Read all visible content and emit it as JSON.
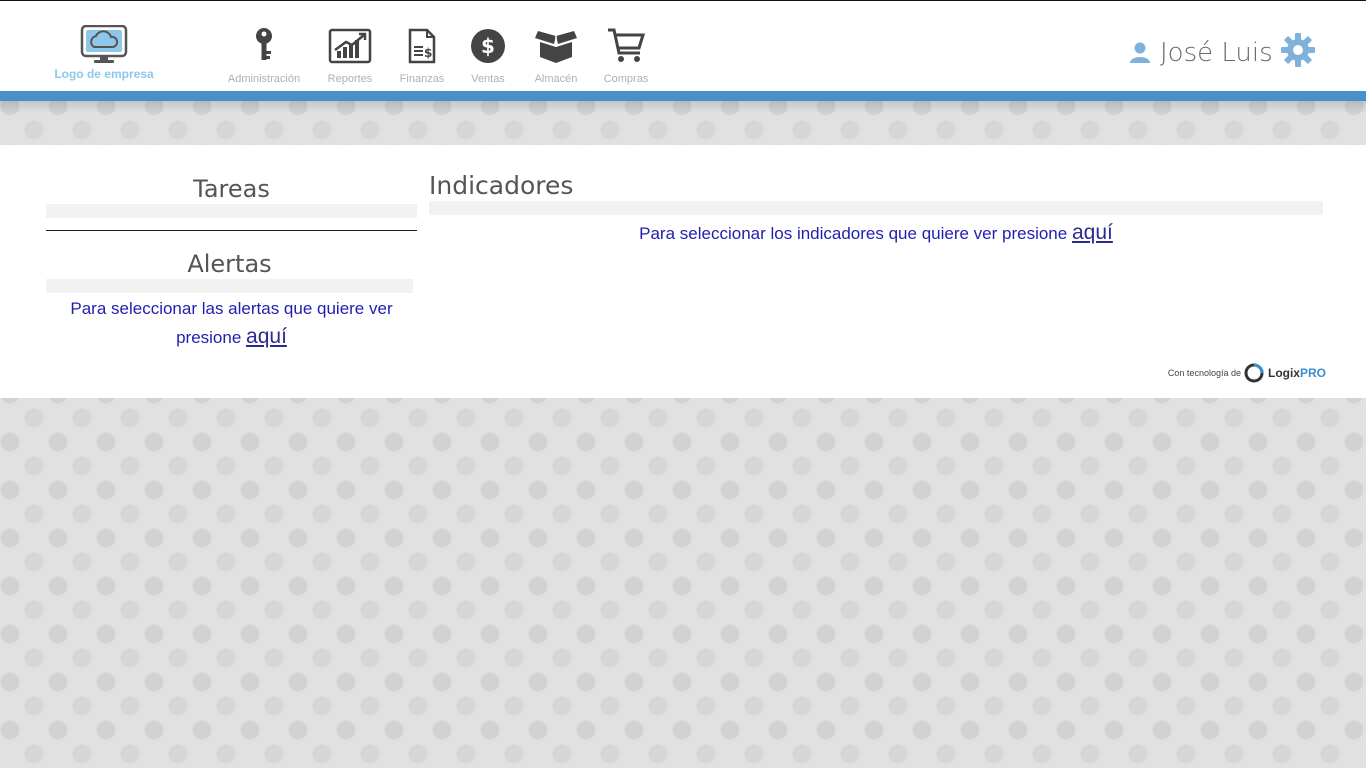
{
  "header": {
    "logo_text": "Logo de empresa",
    "nav": [
      {
        "label": "Administración",
        "icon": "key-icon"
      },
      {
        "label": "Reportes",
        "icon": "chart-icon"
      },
      {
        "label": "Finanzas",
        "icon": "document-dollar-icon"
      },
      {
        "label": "Ventas",
        "icon": "dollar-coin-icon"
      },
      {
        "label": "Almacén",
        "icon": "box-icon"
      },
      {
        "label": "Compras",
        "icon": "cart-icon"
      }
    ],
    "user_name": "José Luis",
    "accent_color": "#4a90c8"
  },
  "left": {
    "tareas_title": "Tareas",
    "alertas_title": "Alertas",
    "alertas_message": "Para seleccionar las alertas que quiere ver presione",
    "alertas_link": "aquí"
  },
  "right": {
    "indicadores_title": "Indicadores",
    "indicadores_message": "Para seleccionar los indicadores que quiere ver presione",
    "indicadores_link": "aquí"
  },
  "footer": {
    "powered_text": "Con tecnología de",
    "brand_prefix": "Logix",
    "brand_suffix": "PRO"
  }
}
